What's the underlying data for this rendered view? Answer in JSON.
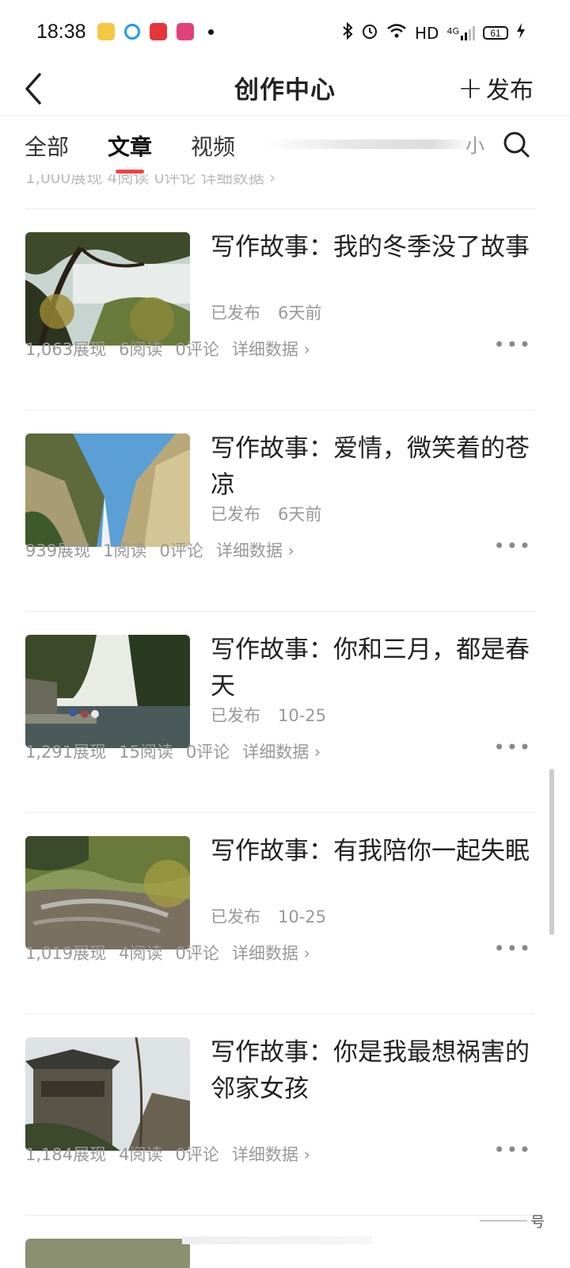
{
  "status_bar": {
    "time": "18:38",
    "network": "HD",
    "signal": "4G",
    "battery": "61"
  },
  "header": {
    "title": "创作中心",
    "publish_label": "发布"
  },
  "tabs": [
    {
      "label": "全部"
    },
    {
      "label": "文章"
    },
    {
      "label": "视频"
    }
  ],
  "tab_partial_text": "小",
  "partial_row_text": "1,000展现  4阅读  0评论  详细数据 ›",
  "articles": [
    {
      "title": "写作故事：我的冬季没了故事",
      "status": "已发布",
      "time": "6天前",
      "views": "1,063展现",
      "reads": "6阅读",
      "comments": "0评论",
      "detail": "详细数据"
    },
    {
      "title": "写作故事：爱情，微笑着的苍凉",
      "status": "已发布",
      "time": "6天前",
      "views": "939展现",
      "reads": "1阅读",
      "comments": "0评论",
      "detail": "详细数据"
    },
    {
      "title": "写作故事：你和三月，都是春天",
      "status": "已发布",
      "time": "10-25",
      "views": "1,291展现",
      "reads": "15阅读",
      "comments": "0评论",
      "detail": "详细数据"
    },
    {
      "title": "写作故事：有我陪你一起失眠",
      "status": "已发布",
      "time": "10-25",
      "views": "1,019展现",
      "reads": "4阅读",
      "comments": "0评论",
      "detail": "详细数据"
    },
    {
      "title": "写作故事：你是我最想祸害的邻家女孩",
      "status": "",
      "time": "",
      "views": "1,184展现",
      "reads": "4阅读",
      "comments": "0评论",
      "detail": "详细数据"
    }
  ],
  "corner_text": "号"
}
